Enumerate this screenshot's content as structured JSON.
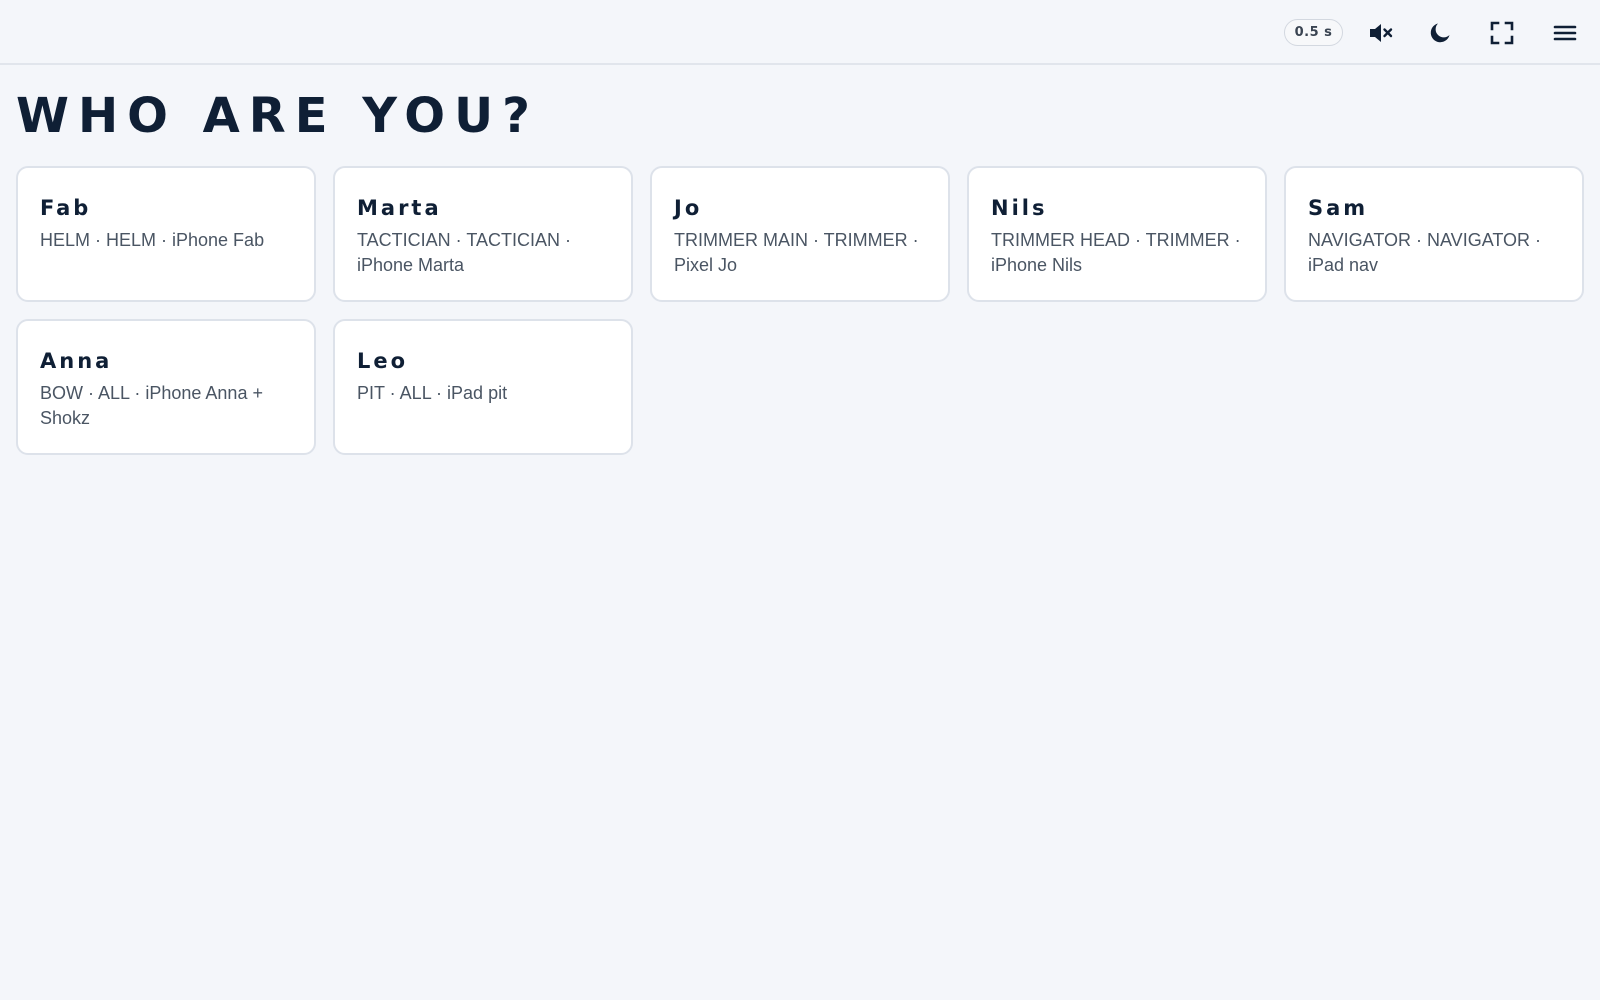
{
  "topbar": {
    "delay_label": "0.5 s",
    "icons": {
      "mute": "speaker-muted-icon",
      "theme": "moon-icon",
      "fullscreen": "fullscreen-icon",
      "menu": "hamburger-menu-icon"
    }
  },
  "page": {
    "title": "WHO ARE YOU?"
  },
  "crew": [
    {
      "name": "Fab",
      "details": "HELM · HELM · iPhone Fab"
    },
    {
      "name": "Marta",
      "details": "TACTICIAN · TACTICIAN · iPhone Marta"
    },
    {
      "name": "Jo",
      "details": "TRIMMER MAIN · TRIMMER · Pixel Jo"
    },
    {
      "name": "Nils",
      "details": "TRIMMER HEAD · TRIMMER · iPhone Nils"
    },
    {
      "name": "Sam",
      "details": "NAVIGATOR · NAVIGATOR · iPad nav"
    },
    {
      "name": "Anna",
      "details": "BOW · ALL · iPhone Anna + Shokz"
    },
    {
      "name": "Leo",
      "details": "PIT · ALL · iPad pit"
    }
  ],
  "colors": {
    "background": "#f4f6fa",
    "card": "#ffffff",
    "card_border": "#dde2ea",
    "heading": "#0f1f35",
    "subtext": "#4a5563"
  }
}
